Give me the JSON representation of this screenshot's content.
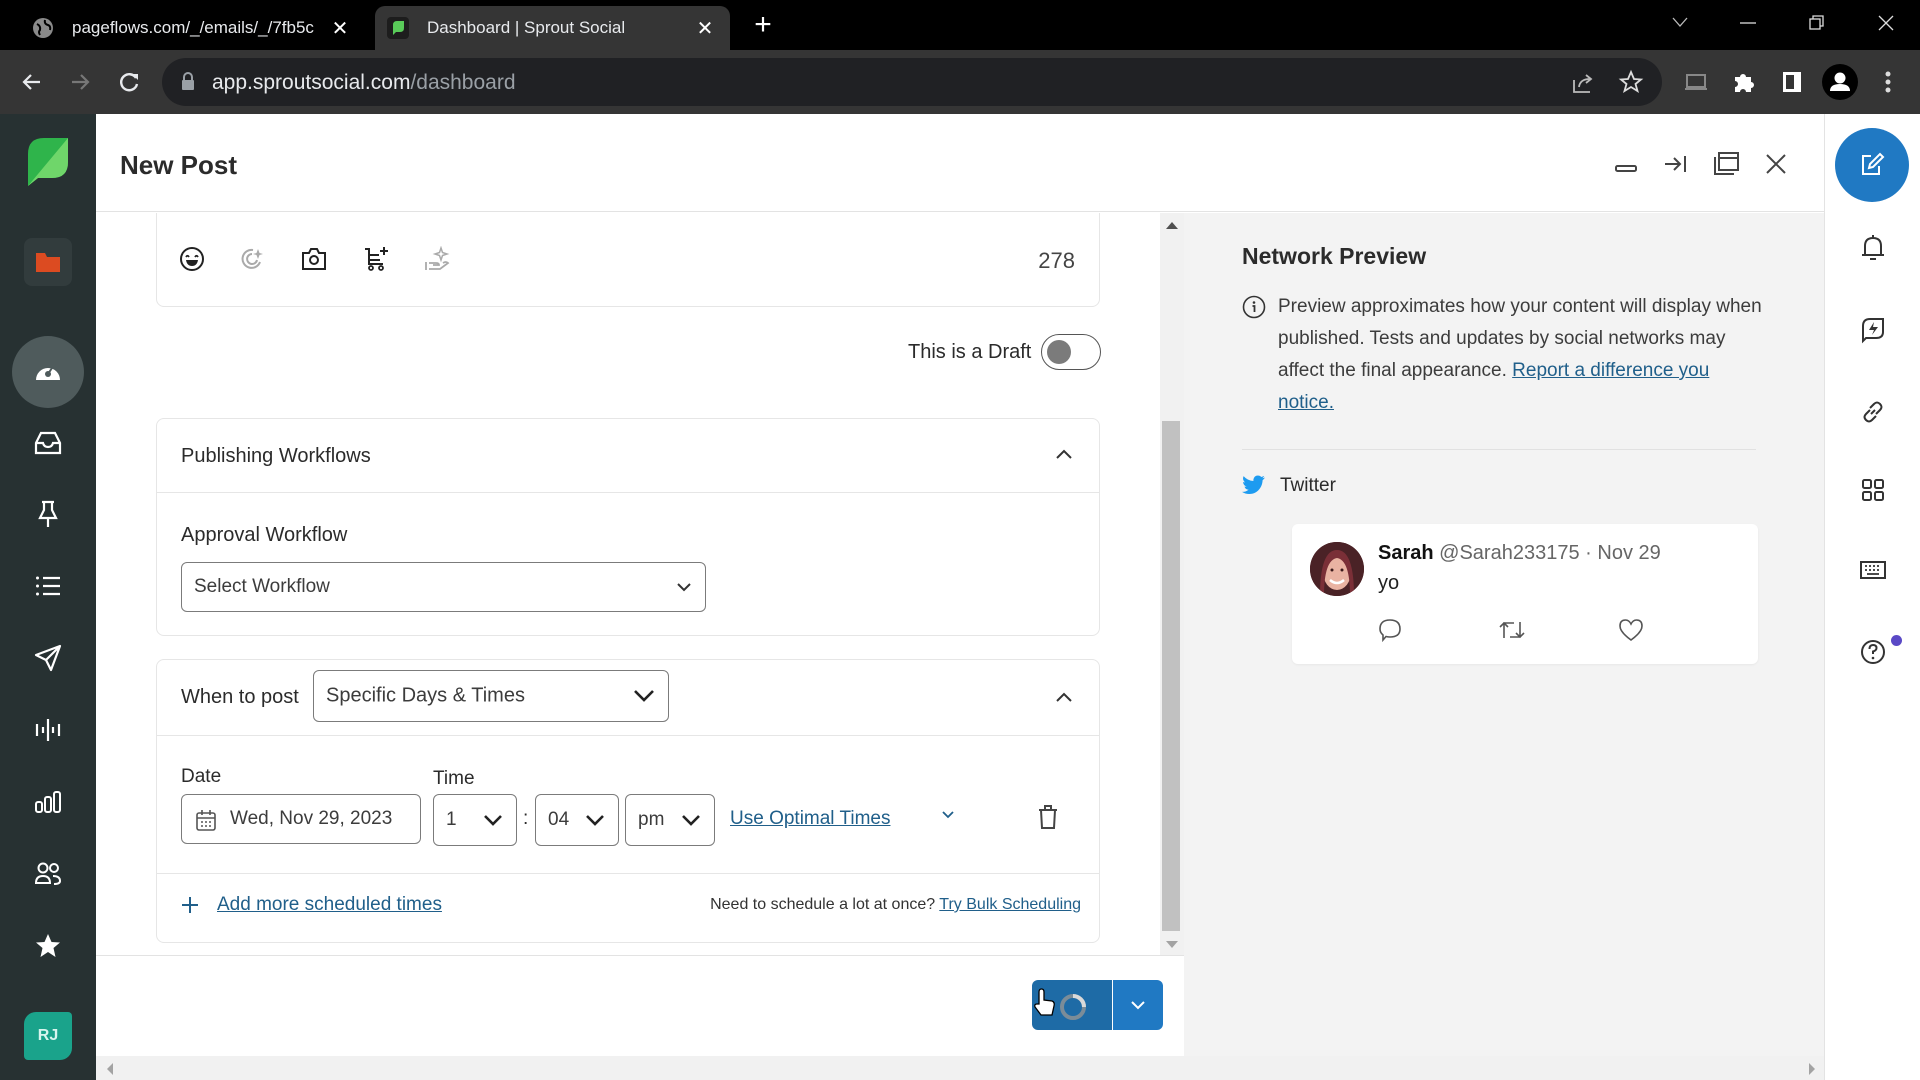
{
  "browser": {
    "tabs": [
      {
        "title": "pageflows.com/_/emails/_/7fb5c",
        "active": false,
        "icon": "globe-icon"
      },
      {
        "title": "Dashboard | Sprout Social",
        "active": true,
        "icon": "sprout-favicon"
      }
    ],
    "url_host": "app.sproutsocial.com",
    "url_path": "/dashboard"
  },
  "left_nav": {
    "items": [
      {
        "name": "sprout-logo",
        "label": "Sprout Social"
      },
      {
        "name": "folder-icon",
        "label": "Briefcase"
      },
      {
        "name": "dashboard-icon",
        "label": "Dashboard",
        "active": true
      },
      {
        "name": "inbox-icon",
        "label": "Inbox"
      },
      {
        "name": "pin-icon",
        "label": "Tasks"
      },
      {
        "name": "list-icon",
        "label": "Feeds"
      },
      {
        "name": "send-icon",
        "label": "Publishing"
      },
      {
        "name": "listening-icon",
        "label": "Listening"
      },
      {
        "name": "reports-icon",
        "label": "Reports"
      },
      {
        "name": "people-icon",
        "label": "People"
      },
      {
        "name": "star-icon",
        "label": "Reviews"
      }
    ],
    "avatar_initials": "RJ"
  },
  "modal": {
    "title": "New Post",
    "header_actions": [
      "minimize",
      "collapse",
      "pop-out",
      "close"
    ],
    "compose": {
      "toolbar_icons": [
        "emoji-icon",
        "ai-assist-icon",
        "camera-icon",
        "product-icon",
        "hand-sparkle-icon"
      ],
      "char_count": "278",
      "draft_label": "This is a Draft",
      "draft_on": false
    },
    "publishing_workflows": {
      "title": "Publishing Workflows",
      "approval_label": "Approval Workflow",
      "approval_value": "Select Workflow"
    },
    "when_to_post": {
      "label": "When to post",
      "value": "Specific Days & Times",
      "date_label": "Date",
      "date_value": "Wed, Nov 29, 2023",
      "time_label": "Time",
      "hour": "1",
      "minute": "04",
      "ampm": "pm",
      "separator": ":",
      "optimal_link": "Use Optimal Times",
      "add_more": "Add more scheduled times",
      "bulk_prompt": "Need to schedule a lot at once?",
      "bulk_link": "Try Bulk Scheduling"
    },
    "footer": {
      "submit_state": "loading"
    }
  },
  "preview": {
    "title": "Network Preview",
    "info_text": "Preview approximates how your content will display when published. Tests and updates by social networks may affect the final appearance.",
    "info_link": "Report a difference you notice.",
    "network": "Twitter",
    "tweet": {
      "name": "Sarah",
      "handle": "@Sarah233175",
      "sep": "·",
      "date": "Nov 29",
      "text": "yo"
    }
  },
  "right_rail": {
    "compose_icon": "compose-icon",
    "items": [
      "bell-icon",
      "feedback-icon",
      "link-icon",
      "apps-icon",
      "keyboard-icon",
      "help-icon"
    ]
  },
  "colors": {
    "brand_green": "#59cb59",
    "primary_blue": "#2079c3",
    "link": "#205f8a",
    "nav_bg": "#273132",
    "avatar_teal": "#1aa38b",
    "notification_dot": "#5a49c6"
  }
}
